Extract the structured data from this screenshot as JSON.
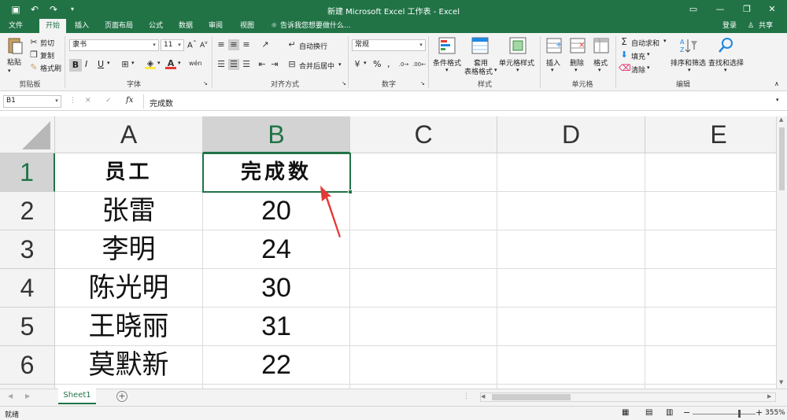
{
  "titlebar": {
    "title": "新建 Microsoft Excel 工作表 - Excel"
  },
  "tabs": [
    {
      "label": "文件"
    },
    {
      "label": "开始"
    },
    {
      "label": "插入"
    },
    {
      "label": "页面布局"
    },
    {
      "label": "公式"
    },
    {
      "label": "数据"
    },
    {
      "label": "审阅"
    },
    {
      "label": "视图"
    }
  ],
  "tellme": "告诉我您想要做什么...",
  "account": {
    "login": "登录",
    "share": "共享"
  },
  "ribbon": {
    "clipboard": {
      "paste": "粘贴",
      "cut": "剪切",
      "copy": "复制",
      "format_painter": "格式刷",
      "label": "剪贴板"
    },
    "font": {
      "name": "隶书",
      "size": "11",
      "bold": "B",
      "italic": "I",
      "underline": "U",
      "label": "字体"
    },
    "alignment": {
      "wrap": "自动换行",
      "merge": "合并后居中",
      "label": "对齐方式"
    },
    "number": {
      "format": "常规",
      "percent": "%",
      "comma": ",",
      "label": "数字"
    },
    "styles": {
      "conditional": "条件格式",
      "table1": "套用",
      "table2": "表格格式",
      "cell_styles": "单元格样式",
      "label": "样式"
    },
    "cells": {
      "insert": "插入",
      "delete": "删除",
      "format": "格式",
      "label": "单元格"
    },
    "editing": {
      "autosum": "自动求和",
      "fill": "填充",
      "clear": "清除",
      "sort": "排序和筛选",
      "find": "查找和选择",
      "label": "编辑"
    }
  },
  "formula": {
    "namebox": "B1",
    "fx": "fx",
    "content": "完成数"
  },
  "columns": [
    "A",
    "B",
    "C",
    "D",
    "E"
  ],
  "rows": [
    "1",
    "2",
    "3",
    "4",
    "5",
    "6"
  ],
  "cells": [
    [
      "员工",
      "完成数"
    ],
    [
      "张雷",
      "20"
    ],
    [
      "李明",
      "24"
    ],
    [
      "陈光明",
      "30"
    ],
    [
      "王晓丽",
      "31"
    ],
    [
      "莫默新",
      "22"
    ]
  ],
  "sheet": {
    "name": "Sheet1"
  },
  "status": {
    "ready": "就绪",
    "zoom": "355%"
  },
  "colors": {
    "accent": "#217346",
    "arrow": "#e53935"
  }
}
